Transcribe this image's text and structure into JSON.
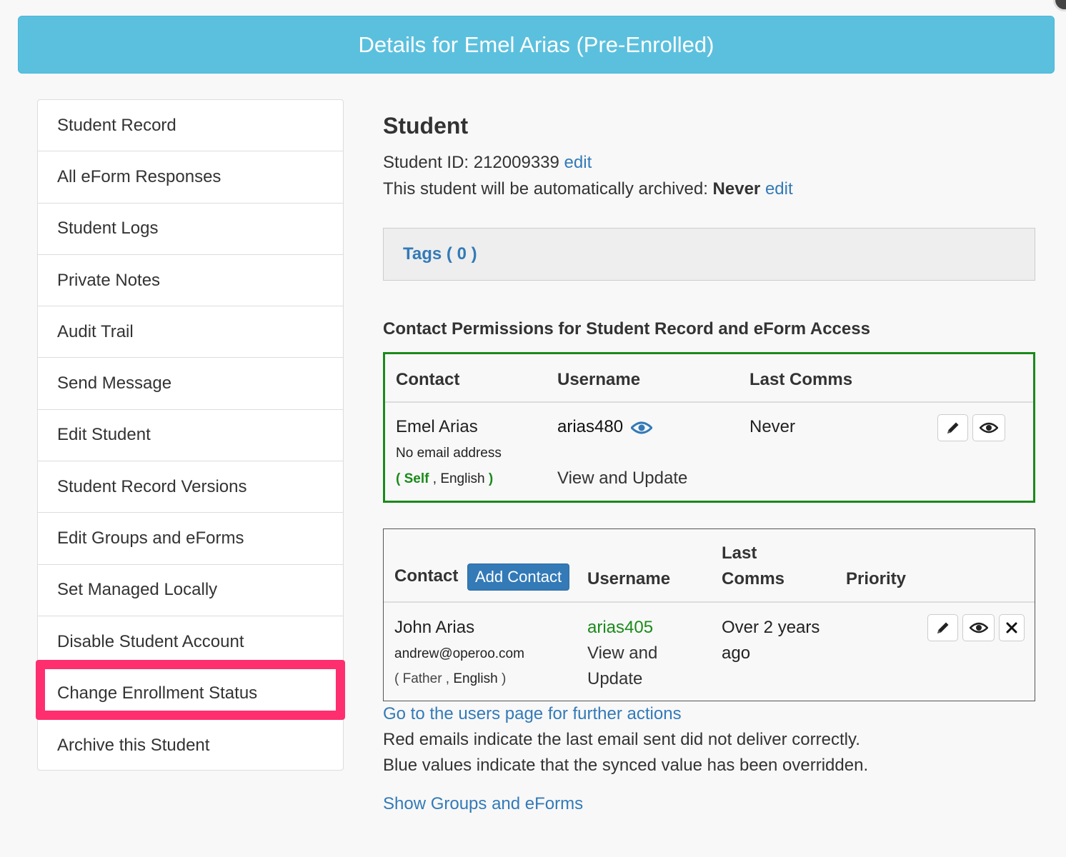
{
  "header": {
    "title": "Details for Emel Arias (Pre-Enrolled)"
  },
  "sidebar": {
    "items": [
      {
        "label": "Student Record"
      },
      {
        "label": "All eForm Responses"
      },
      {
        "label": "Student Logs"
      },
      {
        "label": "Private Notes"
      },
      {
        "label": "Audit Trail"
      },
      {
        "label": "Send Message"
      },
      {
        "label": "Edit Student"
      },
      {
        "label": "Student Record Versions"
      },
      {
        "label": "Edit Groups and eForms"
      },
      {
        "label": "Set Managed Locally"
      },
      {
        "label": "Disable Student Account"
      },
      {
        "label": "Change Enrollment Status"
      },
      {
        "label": "Archive this Student"
      }
    ],
    "highlighted_index": 11,
    "highlight_color": "#ff2e6e"
  },
  "student": {
    "section_title": "Student",
    "id_label": "Student ID: 212009339",
    "edit_label": "edit",
    "archive_prefix": "This student will be automatically archived:",
    "archive_value": "Never",
    "archive_edit_label": "edit"
  },
  "tags": {
    "label": "Tags ( 0 )"
  },
  "permissions": {
    "title": "Contact Permissions for Student Record and eForm Access",
    "headers": {
      "contact": "Contact",
      "username": "Username",
      "last_comms": "Last Comms"
    },
    "row": {
      "name": "Emel Arias",
      "email": "No email address",
      "rel_open": "(",
      "relation": "Self",
      "comma": ",",
      "language": "English",
      "rel_close": ")",
      "username": "arias480",
      "access": "View and Update",
      "last_comms": "Never"
    },
    "border_color": "#1a8a1a"
  },
  "contacts": {
    "headers": {
      "contact": "Contact",
      "add_button": "Add Contact",
      "username": "Username",
      "last_line1": "Last",
      "last_line2": "Comms",
      "priority": "Priority"
    },
    "row": {
      "name": "John Arias",
      "email": "andrew@operoo.com",
      "relation_line": "( Father ,",
      "language": "English",
      "rel_close": ")",
      "username": "arias405",
      "access_line1": "View and",
      "access_line2": "Update",
      "last_line1": "Over 2 years",
      "last_line2": "ago"
    }
  },
  "footer": {
    "users_link": "Go to the users page for further actions",
    "note_red": "Red emails indicate the last email sent did not deliver correctly.",
    "note_blue": "Blue values indicate that the synced value has been overridden.",
    "groups_link": "Show Groups and eForms"
  },
  "colors": {
    "header": "#5bc0de",
    "link": "#337ab7",
    "green": "#1a8a1a"
  }
}
